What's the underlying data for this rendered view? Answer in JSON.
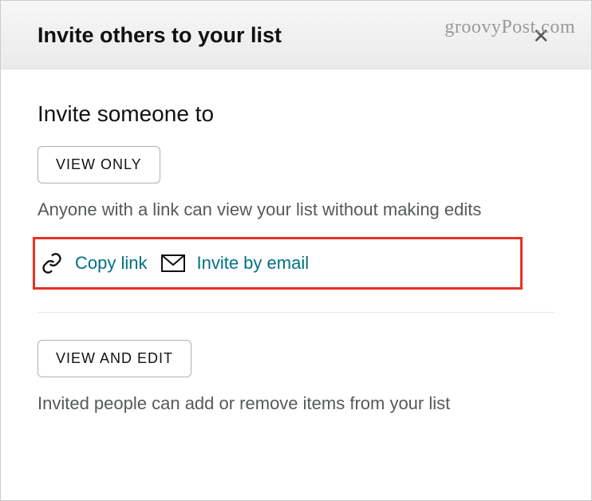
{
  "watermark": "groovyPost.com",
  "header": {
    "title": "Invite others to your list"
  },
  "subheading": "Invite someone to",
  "viewOnly": {
    "buttonLabel": "VIEW ONLY",
    "description": "Anyone with a link can view your list without making edits",
    "copyLinkLabel": "Copy link",
    "inviteByEmailLabel": "Invite by email"
  },
  "viewAndEdit": {
    "buttonLabel": "VIEW AND EDIT",
    "description": "Invited people can add or remove items from your list"
  }
}
